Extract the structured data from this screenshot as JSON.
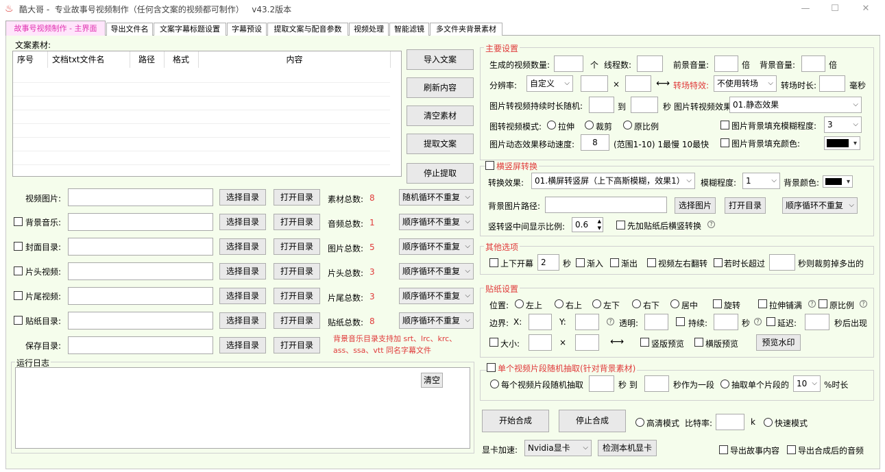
{
  "title": {
    "app": "酷大哥 -",
    "subtitle": "专业故事号视频制作（任何含文案的视频都可制作）",
    "version": "v43.2版本"
  },
  "tabs": [
    "故事号视频制作 - 主界面",
    "导出文件名",
    "文案字幕标题设置",
    "字幕预设",
    "提取文案与配音参数",
    "视频处理",
    "智能滤镜",
    "多文件夹背景素材"
  ],
  "left": {
    "material_label": "文案素材:",
    "table_headers": [
      "序号",
      "文档txt文件名",
      "路径",
      "格式",
      "内容"
    ],
    "side_buttons": [
      "导入文案",
      "刷新内容",
      "清空素材",
      "提取文案",
      "停止提取"
    ],
    "rows": [
      {
        "label": "视频图片:",
        "has_check": false,
        "btn1": "选择目录",
        "btn2": "打开目录",
        "count_label": "素材总数:",
        "count": "8",
        "mode": "随机循环不重复"
      },
      {
        "label": "背景音乐:",
        "has_check": true,
        "btn1": "选择目录",
        "btn2": "打开目录",
        "count_label": "音频总数:",
        "count": "1",
        "mode": "顺序循环不重复"
      },
      {
        "label": "封面目录:",
        "has_check": true,
        "btn1": "选择目录",
        "btn2": "打开目录",
        "count_label": "图片总数:",
        "count": "5",
        "mode": "顺序循环不重复"
      },
      {
        "label": "片头视频:",
        "has_check": true,
        "btn1": "选择目录",
        "btn2": "打开目录",
        "count_label": "片头总数:",
        "count": "3",
        "mode": "顺序循环不重复"
      },
      {
        "label": "片尾视频:",
        "has_check": true,
        "btn1": "选择目录",
        "btn2": "打开目录",
        "count_label": "片尾总数:",
        "count": "3",
        "mode": "顺序循环不重复"
      },
      {
        "label": "贴纸目录:",
        "has_check": true,
        "btn1": "选择目录",
        "btn2": "打开目录",
        "count_label": "贴纸总数:",
        "count": "8",
        "mode": "顺序循环不重复"
      }
    ],
    "save": {
      "label": "保存目录:",
      "btn1": "选择目录",
      "btn2": "打开目录"
    },
    "note1": "背景音乐目录支持加 srt、lrc、krc、",
    "note2": "ass、ssa、vtt 同名字幕文件",
    "log_title": "运行日志",
    "clear_btn": "清空"
  },
  "main": {
    "title": "主要设置",
    "video_count": "生成的视频数量:",
    "unit_ge": "个",
    "threads": "线程数:",
    "fg_vol": "前景音量:",
    "bei": "倍",
    "bg_vol": "背景音量:",
    "resolution": "分辨率:",
    "res_value": "自定义",
    "times": "×",
    "swap": "⟷",
    "transition": "转场特效:",
    "trans_value": "不使用转场",
    "trans_dur": "转场时长:",
    "ms": "毫秒",
    "img_dur": "图片转视频持续时长随机:",
    "to": "到",
    "sec": "秒",
    "img_effect": "图片转视频效果:",
    "img_effect_value": "01.静态效果",
    "img_mode": "图转视频模式:",
    "stretch": "拉伸",
    "crop": "裁剪",
    "keep": "原比例",
    "blur_label": "图片背景填充模糊程度:",
    "blur_value": "3",
    "speed": "图片动态效果移动速度:",
    "speed_value": "8",
    "speed_hint": "(范围1-10) 1最慢 10最快",
    "fill_color": "图片背景填充颜色:"
  },
  "hv": {
    "title": "横竖屏转换",
    "effect": "转换效果:",
    "effect_value": "01.横屏转竖屏（上下高斯模糊，效果1）",
    "blur": "模糊程度:",
    "blur_value": "1",
    "bg_color": "背景颜色:",
    "bg_path": "背景图片路径:",
    "sel_img": "选择图片",
    "open_dir": "打开目录",
    "mode": "顺序循环不重复",
    "ratio": "竖转竖中间显示比例:",
    "ratio_value": "0.6",
    "sticker_first": "先加贴纸后横竖转换"
  },
  "other": {
    "title": "其他选项",
    "open_label": "上下开幕",
    "open_value": "2",
    "sec": "秒",
    "fadein": "渐入",
    "fadeout": "渐出",
    "flip": "视频左右翻转",
    "over": "若时长超过",
    "cut": "秒则裁剪掉多出的"
  },
  "sticker": {
    "title": "贴纸设置",
    "pos": "位置:",
    "tl": "左上",
    "tr": "右上",
    "bl": "左下",
    "br": "右下",
    "center": "居中",
    "rotate": "旋转",
    "stretch": "拉伸铺满",
    "keep": "原比例",
    "margin": "边界:",
    "x": "X:",
    "y": "Y:",
    "opacity": "透明:",
    "dur": "持续:",
    "sec": "秒",
    "delay": "延迟:",
    "after": "秒后出现",
    "size": "大小:",
    "times": "×",
    "swap": "⟷",
    "vpreview": "竖版预览",
    "hpreview": "横版预览",
    "watermark": "预览水印"
  },
  "seg": {
    "title": "单个视频片段随机抽取(针对背景素材)",
    "each": "每个视频片段随机抽取",
    "sec_to": "秒 到",
    "as_seg": "秒作为一段",
    "single": "抽取单个片段的",
    "pct_value": "10",
    "pct": "%时长"
  },
  "bottom": {
    "start": "开始合成",
    "stop": "停止合成",
    "hq": "高清模式",
    "bitrate": "比特率:",
    "k": "k",
    "fast": "快速模式",
    "gpu": "显卡加速:",
    "gpu_value": "Nvidia显卡",
    "detect": "检测本机显卡",
    "export_story": "导出故事内容",
    "export_audio": "导出合成后的音频"
  },
  "colors": {
    "accent": "#e030b0",
    "red": "#e03a3a",
    "panel": "#f5fdec"
  }
}
